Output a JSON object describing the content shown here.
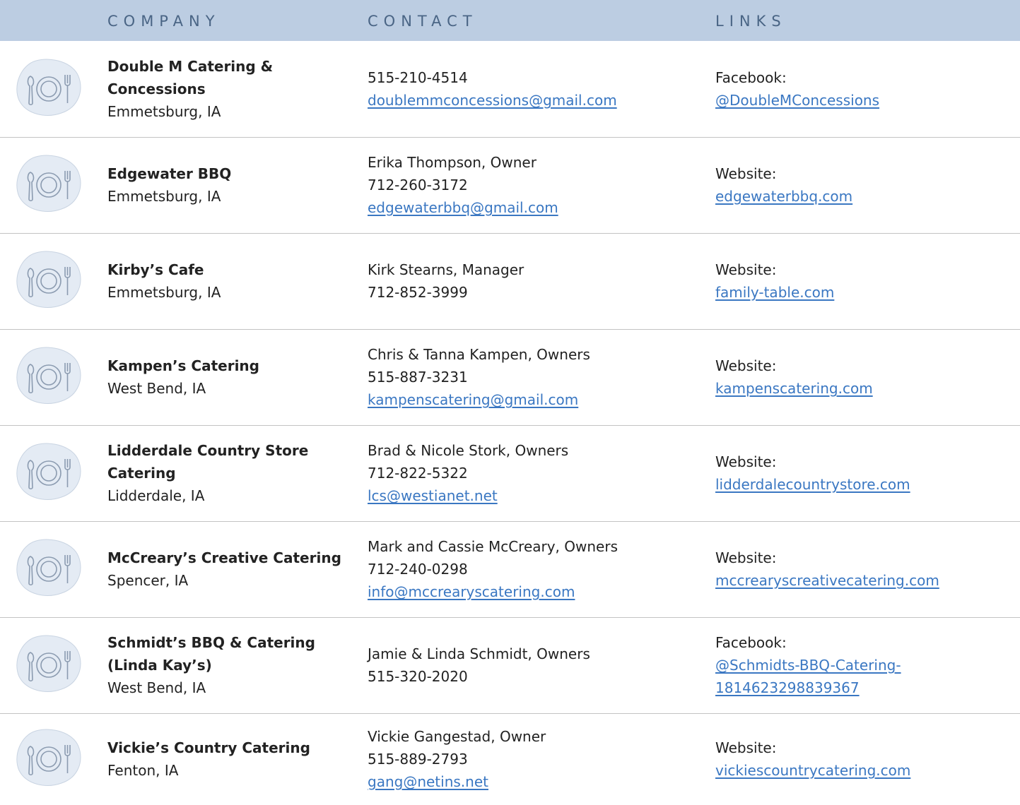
{
  "header": {
    "company": "COMPANY",
    "contact": "CONTACT",
    "links": "LINKS"
  },
  "icon": "plate-and-utensils-icon",
  "colors": {
    "header_bg": "#bccde2",
    "header_text": "#4a6585",
    "link": "#3a77c2",
    "icon_bg": "#e4ebf4",
    "icon_stroke": "#8b9bb0"
  },
  "rows": [
    {
      "name_lines": [
        "Double M Catering &",
        "Concessions"
      ],
      "location": "Emmetsburg, IA",
      "contact_lines": [
        "515-210-4514"
      ],
      "email": "doublemmconcessions@gmail.com",
      "link_label": "Facebook:",
      "link_lines": [
        "@DoubleMConcessions"
      ]
    },
    {
      "name_lines": [
        "Edgewater BBQ"
      ],
      "location": "Emmetsburg, IA",
      "contact_lines": [
        "Erika Thompson, Owner",
        "712-260-3172"
      ],
      "email": "edgewaterbbq@gmail.com",
      "link_label": "Website:",
      "link_lines": [
        "edgewaterbbq.com"
      ]
    },
    {
      "name_lines": [
        "Kirby’s Cafe"
      ],
      "location": "Emmetsburg, IA",
      "contact_lines": [
        "Kirk Stearns, Manager",
        "712-852-3999"
      ],
      "email": "",
      "link_label": "Website:",
      "link_lines": [
        "family-table.com"
      ]
    },
    {
      "name_lines": [
        "Kampen’s Catering"
      ],
      "location": "West Bend, IA",
      "contact_lines": [
        "Chris & Tanna Kampen, Owners",
        "515-887-3231"
      ],
      "email": "kampenscatering@gmail.com",
      "link_label": "Website:",
      "link_lines": [
        "kampenscatering.com"
      ]
    },
    {
      "name_lines": [
        "Lidderdale Country Store",
        "Catering"
      ],
      "location": "Lidderdale, IA",
      "contact_lines": [
        "Brad & Nicole Stork, Owners",
        "712-822-5322"
      ],
      "email": "lcs@westianet.net",
      "link_label": "Website:",
      "link_lines": [
        "lidderdalecountrystore.com"
      ]
    },
    {
      "name_lines": [
        "McCreary’s Creative Catering"
      ],
      "location": "Spencer, IA",
      "contact_lines": [
        "Mark and Cassie McCreary, Owners",
        "712-240-0298"
      ],
      "email": "info@mccrearyscatering.com",
      "link_label": "Website:",
      "link_lines": [
        "mccrearyscreativecatering.com"
      ]
    },
    {
      "name_lines": [
        "Schmidt’s BBQ & Catering",
        "(Linda Kay’s)"
      ],
      "location": "West Bend, IA",
      "contact_lines": [
        "Jamie & Linda Schmidt, Owners",
        "515-320-2020"
      ],
      "email": "",
      "link_label": "Facebook:",
      "link_lines": [
        "@Schmidts-BBQ-Catering-",
        "1814623298839367"
      ]
    },
    {
      "name_lines": [
        "Vickie’s Country Catering"
      ],
      "location": "Fenton, IA",
      "contact_lines": [
        "Vickie Gangestad, Owner",
        "515-889-2793"
      ],
      "email": "gang@netins.net",
      "link_label": "Website:",
      "link_lines": [
        "vickiescountrycatering.com"
      ]
    }
  ]
}
